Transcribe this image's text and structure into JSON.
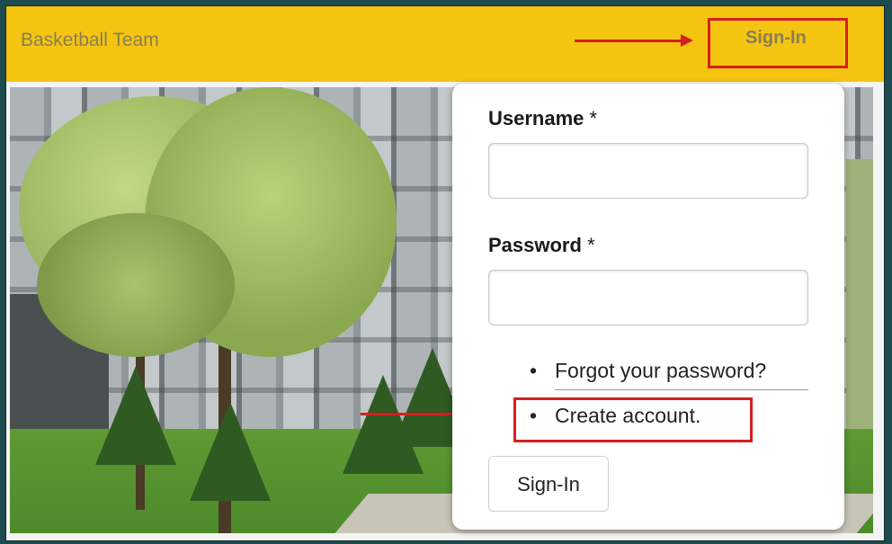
{
  "header": {
    "brand": "Basketball Team",
    "signin_link": "Sign-In"
  },
  "login_form": {
    "username_label": "Username",
    "password_label": "Password",
    "required_marker": "*",
    "username_value": "",
    "password_value": "",
    "links": [
      {
        "bullet": "•",
        "label": "Forgot your password?"
      },
      {
        "bullet": "•",
        "label": "Create account."
      }
    ],
    "submit_label": "Sign-In"
  },
  "colors": {
    "header_bg": "#f4c410",
    "header_text": "#8a7d55",
    "annotation": "#d61f1f",
    "outer_frame": "#1d4b4f"
  }
}
